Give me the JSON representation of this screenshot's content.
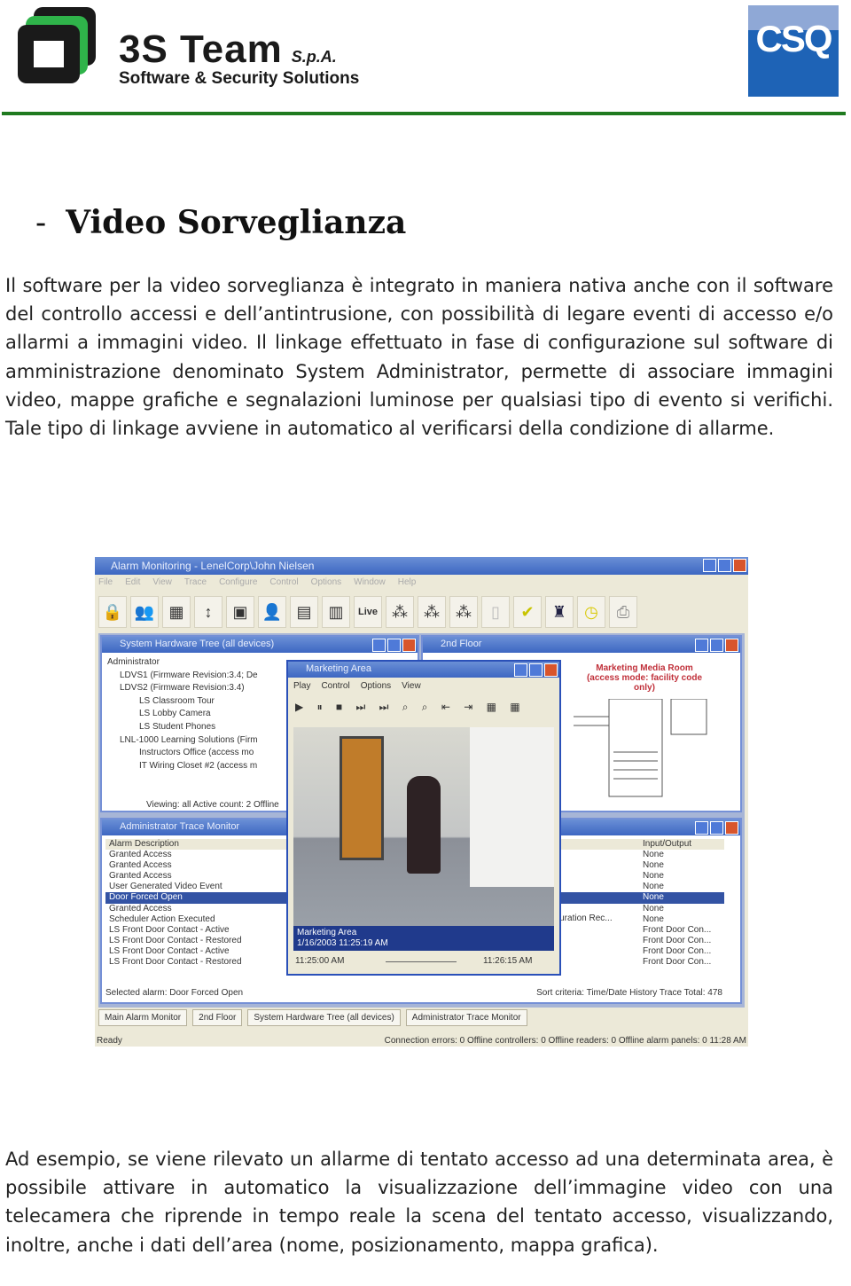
{
  "header": {
    "company_name": "3S Team",
    "company_suffix": "S.p.A.",
    "tagline": "Software & Security Solutions",
    "certification_logo": "CSQ",
    "rule_color": "#1f7a1f"
  },
  "section": {
    "bullet": "-",
    "title": "Video Sorveglianza"
  },
  "paragraphs": [
    "Il software per la video sorveglianza è integrato in maniera nativa anche con il software del controllo accessi e dell’antintrusione, con possibilità di legare eventi di accesso e/o allarmi a immagini video. Il linkage effettuato in fase di configurazione sul software di amministrazione denominato System Administrator, permette di associare immagini video, mappe grafiche e segnalazioni luminose per qualsiasi tipo di evento si verifichi. Tale tipo di linkage avviene in automatico al verificarsi della condizione di allarme.",
    "Ad esempio, se viene rilevato un allarme di tentato accesso ad una determinata area, è possibile attivare in automatico la visualizzazione dell’immagine video con una telecamera che riprende in tempo reale la scena del tentato accesso, visualizzando, inoltre, anche i dati dell’area (nome, posizionamento, mappa grafica)."
  ],
  "screenshot": {
    "title": "Alarm Monitoring - LenelCorp\\John Nielsen",
    "menu": [
      "File",
      "Edit",
      "View",
      "Trace",
      "Configure",
      "Control",
      "Options",
      "Window",
      "Help"
    ],
    "toolbar_live": "Live",
    "hardware_tree": {
      "title": "System Hardware Tree (all devices)",
      "items": [
        "Administrator",
        "LDVS1 (Firmware Revision:3.4; De",
        "LDVS2 (Firmware Revision:3.4)",
        "LS Classroom Tour",
        "LS Lobby Camera",
        "LS Student Phones",
        "LNL-1000 Learning Solutions (Firm",
        "Instructors Office (access mo",
        "IT Wiring Closet #2 (access m"
      ],
      "status": "Viewing: all  Active count: 2  Offline"
    },
    "floor": {
      "title": "2nd Floor",
      "label": "Marketing Media Room (access mode: facility code only)"
    },
    "video": {
      "title": "Marketing Area",
      "menu": [
        "Play",
        "Control",
        "Options",
        "View"
      ],
      "camera": "Marketing Area",
      "timestamp": "1/16/2003 11:25:19 AM",
      "start": "11:25:00 AM",
      "end": "11:26:15 AM"
    },
    "trace": {
      "title": "Administrator Trace Monitor",
      "col_alarm": "Alarm Description",
      "col_io": "Input/Output",
      "rows": [
        "Granted Access",
        "Granted Access",
        "Granted Access",
        "User Generated Video Event",
        "Door Forced Open",
        "Granted Access",
        "Scheduler Action Executed",
        "LS Front Door Contact - Active",
        "LS Front Door Contact - Restored",
        "LS Front Door Contact - Active",
        "LS Front Door Contact - Restored"
      ],
      "io": [
        "None",
        "None",
        "None",
        "None",
        "None",
        "None",
        "None",
        "Front Door Con...",
        "Front Door Con...",
        "Front Door Con...",
        "Front Door Con..."
      ],
      "selected_row": 4,
      "extra": "nfiguration Rec...",
      "selected": "Selected alarm: Door Forced Open",
      "sort": "Sort criteria: Time/Date  History Trace  Total: 478"
    },
    "tabs": [
      "Main Alarm Monitor",
      "2nd Floor",
      "System Hardware Tree (all devices)",
      "Administrator Trace Monitor"
    ],
    "status_left": "Ready",
    "status_right": "Connection errors: 0  Offline controllers: 0  Offline readers: 0  Offline alarm panels: 0  11:28 AM"
  }
}
